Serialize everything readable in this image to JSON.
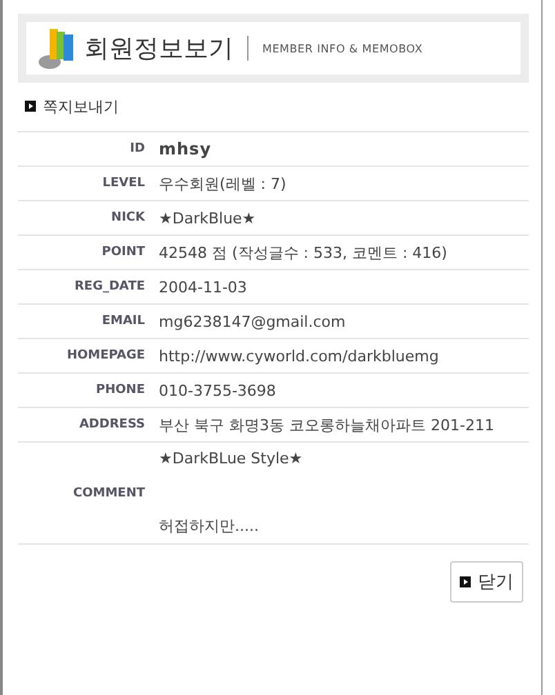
{
  "header": {
    "title": "회원정보보기",
    "subtitle": "MEMBER INFO & MEMOBOX"
  },
  "send_link": "쪽지보내기",
  "fields": [
    {
      "label": "ID",
      "value": "mhsy",
      "kind": "bold"
    },
    {
      "label": "LEVEL",
      "value": "우수회원(레벨 : 7)",
      "kind": "plain"
    },
    {
      "label": "NICK",
      "value": "★DarkBlue★",
      "kind": "plain"
    },
    {
      "label": "POINT",
      "value": "42548 점 (작성글수 : 533, 코멘트 : 416)",
      "kind": "plain"
    },
    {
      "label": "REG_DATE",
      "value": "2004-11-03",
      "kind": "plain"
    },
    {
      "label": "EMAIL",
      "value": "mg6238147@gmail.com",
      "kind": "plain"
    },
    {
      "label": "HOMEPAGE",
      "value": "http://www.cyworld.com/darkbluemg",
      "kind": "plain"
    },
    {
      "label": "PHONE",
      "value": "010-3755-3698",
      "kind": "plain"
    },
    {
      "label": "ADDRESS",
      "value": "부산 북구 화명3동 코오롱하늘채아파트 201-211",
      "kind": "plain"
    }
  ],
  "comment": {
    "label": "COMMENT",
    "lines": [
      "★DarkBLue Style★",
      "허접하지만....."
    ]
  },
  "close_button": "닫기"
}
